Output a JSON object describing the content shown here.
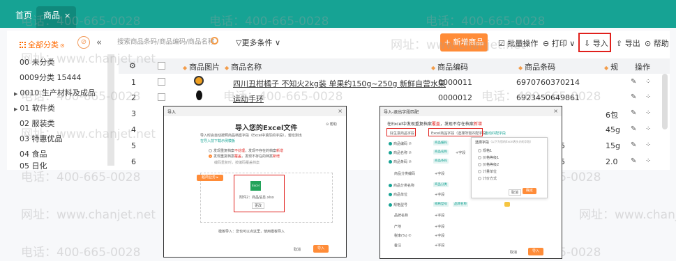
{
  "tabs": {
    "home": "首页",
    "goods": "商品",
    "close": "×"
  },
  "sidebar": {
    "all_categories": "全部分类",
    "edit_icon": "⊘",
    "collapse": "«",
    "items": [
      {
        "label": "00 未分类",
        "arrow": ""
      },
      {
        "label": "0009分类 15444",
        "arrow": ""
      },
      {
        "label": "0010 生产材料及成品",
        "arrow": "▶"
      },
      {
        "label": "01 软件类",
        "arrow": "▶"
      },
      {
        "label": "02 服装类",
        "arrow": ""
      },
      {
        "label": "03 特惠优品",
        "arrow": ""
      },
      {
        "label": "04 食品",
        "arrow": ""
      },
      {
        "label": "05 日化",
        "arrow": ""
      }
    ]
  },
  "toolbar": {
    "search_placeholder": "搜索商品条码/商品编码/商品名称",
    "more_filters": "▽更多条件 ∨",
    "new_product": "+ 新增商品",
    "batch": "☑ 批量操作",
    "print": "⊖ 打印 ∨",
    "import": "⇩ 导入",
    "export": "⇧ 导出",
    "help": "⊙ 帮助"
  },
  "table": {
    "headers": {
      "settings": "⚙",
      "image": "商品图片",
      "name": "商品名称",
      "code": "商品编码",
      "barcode": "商品条码",
      "trunc": "规",
      "ops": "操作"
    },
    "rows": [
      {
        "no": "1",
        "name": "四川丑柑橘子 不知火2kg装 单果约150g~250g 新鲜自营水果",
        "code": "0000011",
        "barcode": "6970760370214",
        "extra": ""
      },
      {
        "no": "2",
        "name": "运动手环",
        "code": "0000012",
        "barcode": "6923450649861",
        "extra": ""
      },
      {
        "no": "3",
        "name": "",
        "code": "",
        "barcode": "",
        "extra": "6包"
      },
      {
        "no": "4",
        "name": "",
        "code": "",
        "barcode": "",
        "extra": "45g"
      },
      {
        "no": "5",
        "name": "",
        "code": "",
        "barcode": "5",
        "extra": "15g"
      },
      {
        "no": "6",
        "name": "",
        "code": "",
        "barcode": "5",
        "extra": "2.0"
      }
    ],
    "op_edit": "✎",
    "op_more": "⁘"
  },
  "watermark": {
    "phone": "电话：400-665-0028",
    "site": "网址：www.chanjet.net"
  },
  "dialog1": {
    "window_title": "导入",
    "heading": "导入您的Excel文件",
    "desc1": "导入时会自动按照商品档案字段（Excel中填写的字段），若检测出",
    "desc2": "在导入前下载示例模板",
    "opt1_a": "发现重复档案",
    "opt1_b": "不处理",
    "opt1_c": "，发现不存在的档案",
    "opt1_d": "新增",
    "opt2_a": "发现重复档案",
    "opt2_b": "覆盖",
    "opt2_c": "，发现不存在的档案",
    "opt2_d": "新增",
    "note": "编码重复时，按编码覆盖档案",
    "sample": "超商业务 ▸",
    "file_label": "附件2：商品信息.xlsx",
    "change": "更改",
    "excel": "Excel",
    "footer": "模板导入：您也可以点这里，使用模板导入",
    "cancel": "取消",
    "ok": "导入",
    "top_right": "⊙ 帮助"
  },
  "dialog2": {
    "window_title": "导入-退出字段匹配",
    "heading_a": "在Excel中发现重复档案",
    "heading_b": "覆盖",
    "heading_c": "，发现不存在档案",
    "heading_d": "新增",
    "col_left": "好生意商品字段",
    "col_right": "Excel商品字段（选择所需匹配字段）",
    "link": "自动匹配字段",
    "rows": [
      "商品编码 ⑦",
      "商品名称 ⑦",
      "商品条码 ⑦",
      "商品分类编码",
      "商品分类名称",
      "商品单位",
      "规格型号",
      "品牌名称",
      "产地",
      "税率(%) ⑦",
      "备注"
    ],
    "chips": [
      "商品编码",
      "商品名称",
      "商品条码",
      "商品分类",
      "规格型号",
      "品牌名称"
    ],
    "add": "+字段",
    "pop_title": "选择字段",
    "pop_hint": "（以下为您的Excel表头内的字段）",
    "pop_items": [
      "规格1",
      "价格等级1",
      "价格等级2",
      "计量单位",
      "计价方式"
    ],
    "pop_cancel": "取消",
    "pop_ok": "确定",
    "footer_cancel": "取消",
    "footer_ok": "导入"
  }
}
